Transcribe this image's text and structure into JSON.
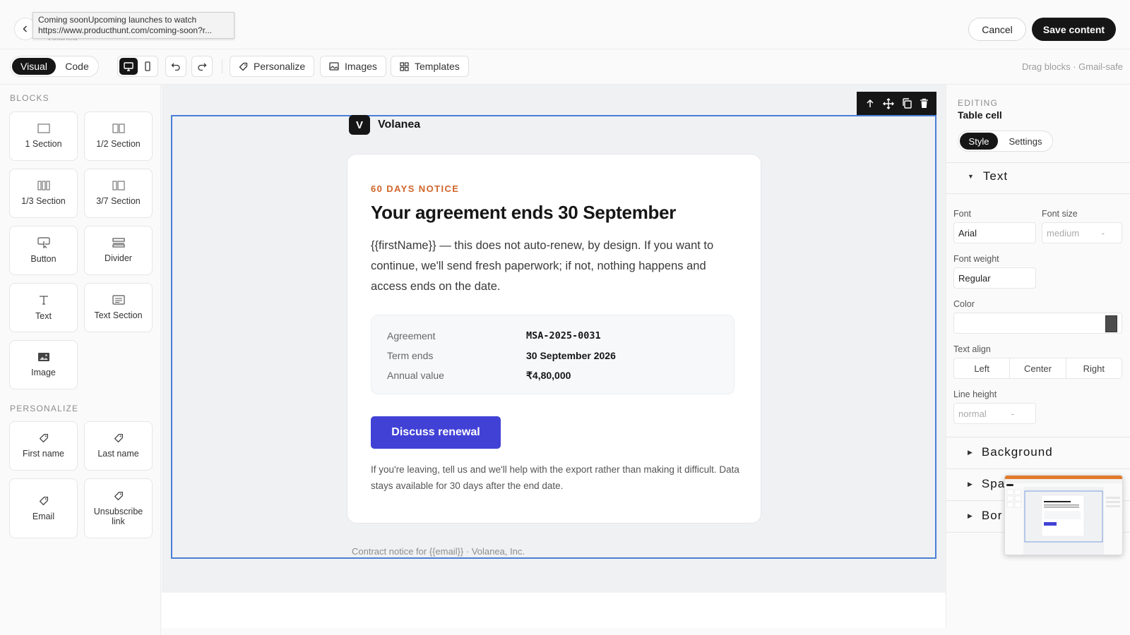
{
  "topbar": {
    "faded_label": "Volanea",
    "tooltip": {
      "title": "Coming soonUpcoming launches to watch",
      "url": "https://www.producthunt.com/coming-soon?r..."
    },
    "cancel_label": "Cancel",
    "save_label": "Save content"
  },
  "toolbar": {
    "modes": [
      "Visual",
      "Code"
    ],
    "active_mode": "Visual",
    "personalize_label": "Personalize",
    "images_label": "Images",
    "templates_label": "Templates",
    "hint": "Drag blocks · Gmail-safe"
  },
  "sidebar": {
    "blocks_heading": "BLOCKS",
    "blocks": [
      {
        "label": "1 Section",
        "icon": "single-column-icon"
      },
      {
        "label": "1/2 Section",
        "icon": "two-column-icon"
      },
      {
        "label": "1/3 Section",
        "icon": "three-column-icon"
      },
      {
        "label": "3/7 Section",
        "icon": "split-column-icon"
      },
      {
        "label": "Button",
        "icon": "button-click-icon"
      },
      {
        "label": "Divider",
        "icon": "divider-icon"
      },
      {
        "label": "Text",
        "icon": "text-icon"
      },
      {
        "label": "Text Section",
        "icon": "text-section-icon"
      },
      {
        "label": "Image",
        "icon": "image-icon"
      }
    ],
    "personalize_heading": "PERSONALIZE",
    "personalize": [
      {
        "label": "First name",
        "icon": "tag-icon"
      },
      {
        "label": "Last name",
        "icon": "tag-icon"
      },
      {
        "label": "Email",
        "icon": "tag-icon"
      },
      {
        "label": "Unsubscribe link",
        "icon": "tag-icon"
      }
    ]
  },
  "email": {
    "brand_initial": "V",
    "brand_name": "Volanea",
    "eyebrow": "60 DAYS NOTICE",
    "headline": "Your agreement ends 30 September",
    "body": "{{firstName}} — this does not auto-renew, by design. If you want to continue, we'll send fresh paperwork; if not, nothing happens and access ends on the date.",
    "details": [
      {
        "label": "Agreement",
        "value": "MSA-2025-0031"
      },
      {
        "label": "Term ends",
        "value": "30 September 2026"
      },
      {
        "label": "Annual value",
        "value": "₹4,80,000"
      }
    ],
    "cta": "Discuss renewal",
    "footnote": "If you're leaving, tell us and we'll help with the export rather than making it difficult. Data stays available for 30 days after the end date.",
    "footer": "Contract notice for {{email}} · Volanea, Inc."
  },
  "panel": {
    "eyebrow": "EDITING",
    "title": "Table cell",
    "tabs": [
      "Style",
      "Settings"
    ],
    "active_tab": "Style",
    "text_section": "Text",
    "font_label": "Font",
    "font_value": "Arial",
    "font_size_label": "Font size",
    "font_size_value": "medium",
    "font_weight_label": "Font weight",
    "font_weight_value": "Regular",
    "color_label": "Color",
    "color_value": "",
    "text_align_label": "Text align",
    "align_options": [
      "Left",
      "Center",
      "Right"
    ],
    "line_height_label": "Line height",
    "line_height_value": "normal",
    "stepper_symbol": "-",
    "sections": [
      "Background",
      "Spa",
      "Bor"
    ]
  },
  "colors": {
    "accent": "#4141d6",
    "eyebrow": "#d0652b",
    "selection": "#4a7fd6",
    "swatch": "#4c4c4c"
  }
}
